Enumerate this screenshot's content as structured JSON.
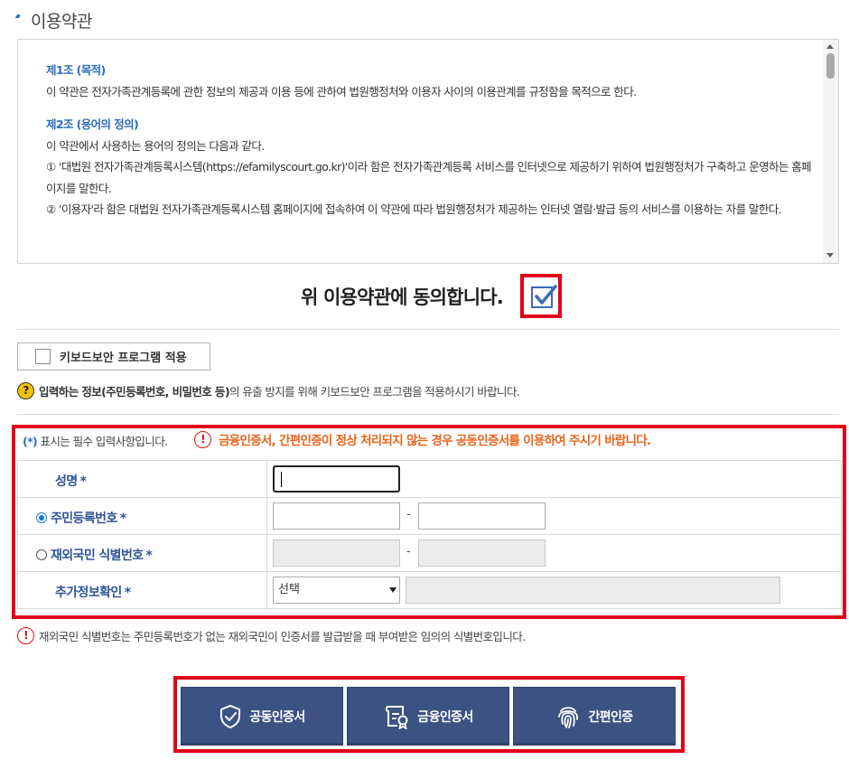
{
  "section_title": "이용약관",
  "terms": {
    "art1_title": "제1조 (목적)",
    "art1_body": "이 약관은 전자가족관계등록에 관한 정보의 제공과 이용 등에 관하여 법원행정처와 이용자 사이의 이용관계를 규정함을 목적으로 한다.",
    "art2_title": "제2조 (용어의 정의)",
    "art2_intro": "이 약관에서 사용하는 용어의 정의는 다음과 같다.",
    "art2_item1": "① '대법원 전자가족관계등록시스템(https://efamilyscourt.go.kr)'이라 함은 전자가족관계등록 서비스를 인터넷으로 제공하기 위하여 법원행정처가 구축하고 운영하는 홈페이지를 말한다.",
    "art2_item2": "② '이용자'라 함은 대법원 전자가족관계등록시스템 홈페이지에 접속하여 이 약관에 따라 법원행정처가 제공하는 인터넷 열람·발급 등의 서비스를 이용하는 자를 말한다."
  },
  "agree": {
    "label": "위 이용약관에 동의합니다.",
    "checked": true
  },
  "keyboard_security": {
    "button_label": "키보드보안 프로그램 적용",
    "note_bold": "입력하는 정보(주민등록번호, 비밀번호 등)",
    "note_rest": "의 유출 방지를 위해 키보드보안 프로그램을 적용하시기 바랍니다."
  },
  "form": {
    "required_note_star": "(*)",
    "required_note": " 표시는 필수 입력사항입니다.",
    "warning": "금융인증서, 간편인증이 정상 처리되지 않는 경우 공동인증서를 이용하여 주시기 바랍니다.",
    "name_label": "성명",
    "rrn_label": "주민등록번호",
    "foreign_label": "재외국민 식별번호",
    "extra_label": "추가정보확인",
    "star": "*",
    "dash": "-",
    "select_value": "선택"
  },
  "foot_note": "재외국민 식별번호는 주민등록번호가 없는 재외국민이 인증서를 발급받을 때 부여받은 임의의 식별번호입니다.",
  "buttons": {
    "joint_cert": "공동인증서",
    "financial_cert": "금융인증서",
    "simple_auth": "간편인증"
  },
  "colors": {
    "accent_blue": "#2d6db8",
    "highlight_red": "#e2001a",
    "warning_orange": "#e9641c",
    "button_navy": "#3b5283"
  }
}
